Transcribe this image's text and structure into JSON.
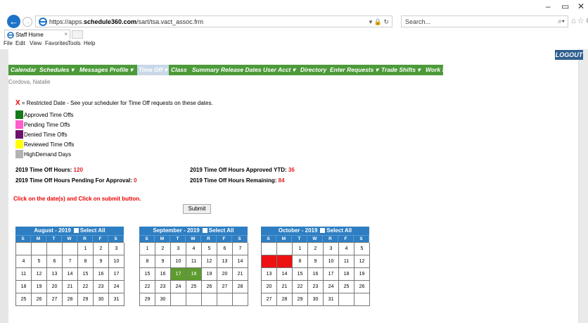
{
  "browser": {
    "url_prefix": "https://apps.",
    "url_domain": "schedule360.com",
    "url_path": "/sart/tsa.vact_assoc.frm",
    "url_controls": "▾ 🔒 ↻",
    "search_placeholder": "Search...",
    "search_icon": "⌕▾",
    "toolbar_icons": "⌂☆⚙",
    "tab_title": "Staff Home",
    "tab_close": "×",
    "window_minimize": "–",
    "window_maximize": "▭",
    "window_close": "✕",
    "back_icon": "←",
    "forward_icon": "→",
    "menu": [
      "File",
      "Edit",
      "View",
      "Favorites",
      "Tools",
      "Help"
    ]
  },
  "header": {
    "logout_label": "LOGOUT"
  },
  "nav": {
    "items": [
      "Calendar",
      "Schedules ▾",
      "Messages",
      "Profile ▾",
      "Time Off ▾",
      "Class",
      "Summary",
      "Release Dates",
      "User Acct ▾",
      "Directory",
      "Enter Requests ▾",
      "Trade Shifts ▾",
      "Work Summary"
    ],
    "active": "Time Off ▾"
  },
  "user_name": "Cordova, Natalie",
  "restricted": {
    "mark": "X",
    "text": " = Restricted Date - See your scheduler for Time Off requests on these dates."
  },
  "legend": [
    {
      "label": "Approved Time Offs",
      "color": "#137a1a"
    },
    {
      "label": "Pending Time Offs",
      "color": "#ff5ccd"
    },
    {
      "label": "Denied Time Offs",
      "color": "#6e0f6e"
    },
    {
      "label": "Reviewed Time Offs",
      "color": "#ffff00"
    },
    {
      "label": "HighDemand Days",
      "color": "#b3b3b3"
    }
  ],
  "stats": {
    "hours_label": "2019 Time Off Hours: ",
    "hours_value": "120",
    "pending_label": "2019 Time Off Hours Pending For Approval: ",
    "pending_value": "0",
    "approved_label": "2019 Time Off Hours Approved YTD: ",
    "approved_value": "36",
    "remaining_label": "2019 Time Off Hours Remaining: ",
    "remaining_value": "84"
  },
  "instruction": "Click on the date(s) and Click on submit button.",
  "submit_label": "Submit",
  "calendars": [
    {
      "title": "August - 2019",
      "select_all": "Select All",
      "days": [
        "",
        "",
        "",
        "",
        "1",
        "2",
        "3",
        "4",
        "5",
        "6",
        "7",
        "8",
        "9",
        "10",
        "11",
        "12",
        "13",
        "14",
        "15",
        "16",
        "17",
        "18",
        "19",
        "20",
        "21",
        "22",
        "23",
        "24",
        "25",
        "26",
        "27",
        "28",
        "29",
        "30",
        "31"
      ],
      "approved": [],
      "restricted": []
    },
    {
      "title": "September - 2019",
      "select_all": "Select All",
      "days": [
        "1",
        "2",
        "3",
        "4",
        "5",
        "6",
        "7",
        "8",
        "9",
        "10",
        "11",
        "12",
        "13",
        "14",
        "15",
        "16",
        "17",
        "18",
        "19",
        "20",
        "21",
        "22",
        "23",
        "24",
        "25",
        "26",
        "27",
        "28",
        "29",
        "30",
        "",
        "",
        "",
        "",
        ""
      ],
      "approved": [
        "17",
        "18"
      ],
      "restricted": []
    },
    {
      "title": "October - 2019",
      "select_all": "Select All",
      "days": [
        "",
        "",
        "1",
        "2",
        "3",
        "4",
        "5",
        "6",
        "7",
        "8",
        "9",
        "10",
        "11",
        "12",
        "13",
        "14",
        "15",
        "16",
        "17",
        "18",
        "19",
        "20",
        "21",
        "22",
        "23",
        "24",
        "25",
        "26",
        "27",
        "28",
        "29",
        "30",
        "31",
        "",
        ""
      ],
      "approved": [],
      "restricted": [
        "6",
        "7"
      ]
    }
  ],
  "weekdays": [
    "S",
    "M",
    "T",
    "W",
    "R",
    "F",
    "S"
  ]
}
